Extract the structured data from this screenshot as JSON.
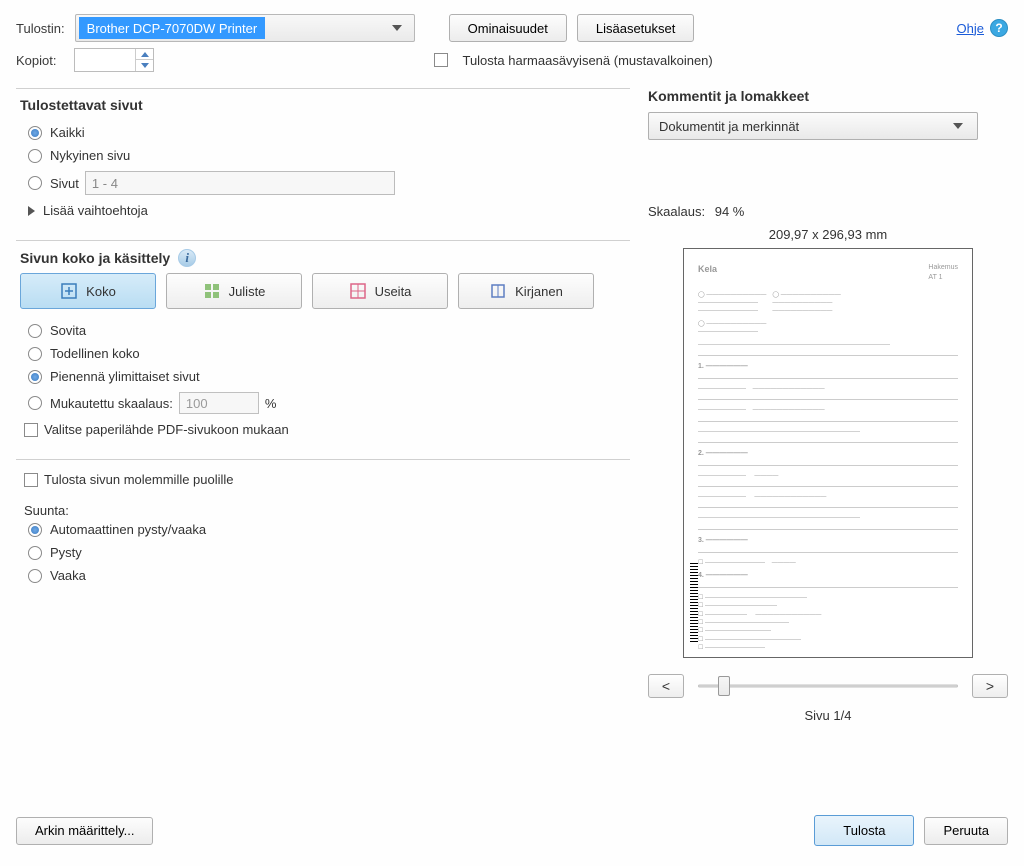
{
  "top": {
    "printer_label": "Tulostin:",
    "printer_value": "Brother DCP-7070DW Printer",
    "properties_btn": "Ominaisuudet",
    "advanced_btn": "Lisäasetukset",
    "help_link": "Ohje",
    "copies_label": "Kopiot:",
    "grayscale_label": "Tulosta harmaasävyisenä (mustavalkoinen)"
  },
  "pages": {
    "title": "Tulostettavat sivut",
    "all": "Kaikki",
    "current": "Nykyinen sivu",
    "range_label": "Sivut",
    "range_value": "1 - 4",
    "more_options": "Lisää vaihtoehtoja"
  },
  "sizing": {
    "title": "Sivun koko ja käsittely",
    "tab_size": "Koko",
    "tab_poster": "Juliste",
    "tab_multiple": "Useita",
    "tab_booklet": "Kirjanen",
    "fit": "Sovita",
    "actual": "Todellinen koko",
    "shrink": "Pienennä ylimittaiset sivut",
    "custom_label": "Mukautettu skaalaus:",
    "custom_value": "100",
    "custom_pct": "%",
    "paper_source": "Valitse paperilähde PDF-sivukoon mukaan"
  },
  "orient": {
    "both_sides": "Tulosta sivun molemmille puolille",
    "direction_label": "Suunta:",
    "auto": "Automaattinen pysty/vaaka",
    "portrait": "Pysty",
    "landscape": "Vaaka"
  },
  "comments": {
    "title": "Kommentit ja lomakkeet",
    "value": "Dokumentit ja merkinnät"
  },
  "preview": {
    "scale_label": "Skaalaus:",
    "scale_value": "94 %",
    "dimensions": "209,97 x 296,93 mm",
    "page_indicator": "Sivu 1/4",
    "prev": "<",
    "next": ">"
  },
  "footer": {
    "page_setup": "Arkin määrittely...",
    "print": "Tulosta",
    "cancel": "Peruuta"
  }
}
